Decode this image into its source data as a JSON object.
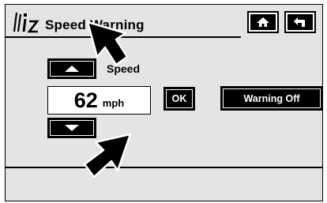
{
  "header": {
    "title": "Speed Warning",
    "logo_icon": "menu-list-icon",
    "home_icon": "home-icon",
    "back_icon": "back-arrow-icon"
  },
  "speed": {
    "label": "Speed",
    "value": "62",
    "unit": "mph",
    "increase_icon": "triangle-up-icon",
    "decrease_icon": "triangle-down-icon"
  },
  "buttons": {
    "ok_label": "OK",
    "warning_off_label": "Warning Off"
  },
  "annotations": {
    "pointer_icons": [
      "pointer-arrow-icon",
      "pointer-arrow-icon"
    ]
  },
  "colors": {
    "background": "#e4e4e4",
    "button": "#000000",
    "button_text": "#ffffff"
  }
}
